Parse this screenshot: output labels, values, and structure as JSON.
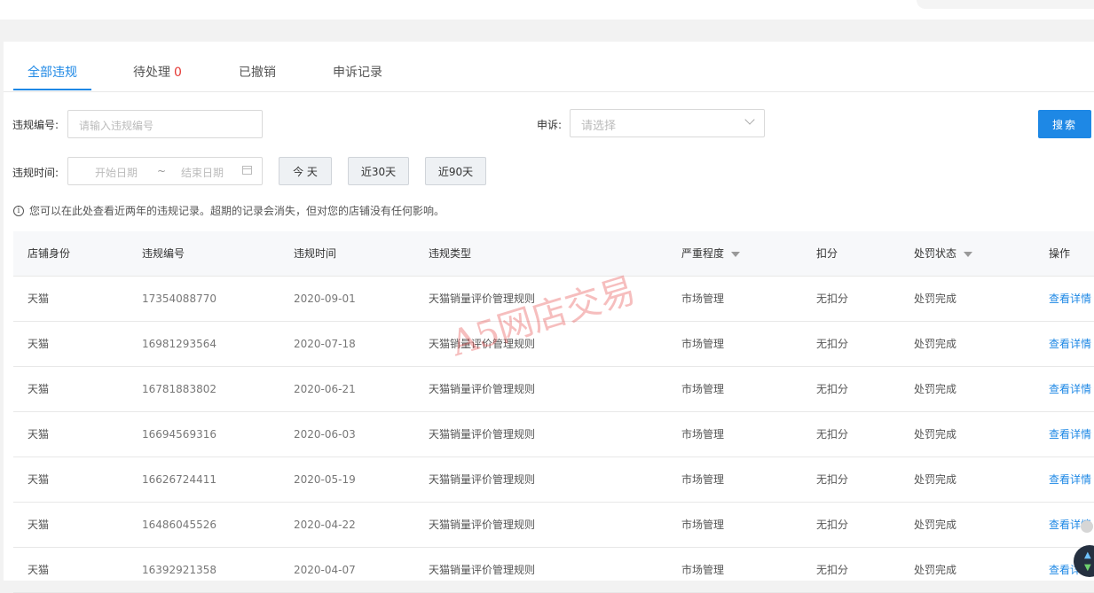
{
  "tabs": [
    {
      "label": "全部违规",
      "count": ""
    },
    {
      "label": "待处理",
      "count": "0"
    },
    {
      "label": "已撤销",
      "count": ""
    },
    {
      "label": "申诉记录",
      "count": ""
    }
  ],
  "filters": {
    "violation_no_label": "违规编号:",
    "violation_no_placeholder": "请输入违规编号",
    "appeal_label": "申诉:",
    "appeal_placeholder": "请选择",
    "search_button": "搜索",
    "time_label": "违规时间:",
    "start_placeholder": "开始日期",
    "separator": "~",
    "end_placeholder": "结束日期",
    "today_button": "今 天",
    "last30_button": "近30天",
    "last90_button": "近90天"
  },
  "notice": "您可以在此处查看近两年的违规记录。超期的记录会消失，但对您的店铺没有任何影响。",
  "table": {
    "headers": [
      "店铺身份",
      "违规编号",
      "违规时间",
      "违规类型",
      "严重程度",
      "扣分",
      "处罚状态",
      "操作"
    ],
    "rows": [
      [
        "天猫",
        "17354088770",
        "2020-09-01",
        "天猫销量评价管理规则",
        "市场管理",
        "无扣分",
        "处罚完成",
        "查看详情"
      ],
      [
        "天猫",
        "16981293564",
        "2020-07-18",
        "天猫销量评价管理规则",
        "市场管理",
        "无扣分",
        "处罚完成",
        "查看详情"
      ],
      [
        "天猫",
        "16781883802",
        "2020-06-21",
        "天猫销量评价管理规则",
        "市场管理",
        "无扣分",
        "处罚完成",
        "查看详情"
      ],
      [
        "天猫",
        "16694569316",
        "2020-06-03",
        "天猫销量评价管理规则",
        "市场管理",
        "无扣分",
        "处罚完成",
        "查看详情"
      ],
      [
        "天猫",
        "16626724411",
        "2020-05-19",
        "天猫销量评价管理规则",
        "市场管理",
        "无扣分",
        "处罚完成",
        "查看详情"
      ],
      [
        "天猫",
        "16486045526",
        "2020-04-22",
        "天猫销量评价管理规则",
        "市场管理",
        "无扣分",
        "处罚完成",
        "查看详情"
      ],
      [
        "天猫",
        "16392921358",
        "2020-04-07",
        "天猫销量评价管理规则",
        "市场管理",
        "无扣分",
        "处罚完成",
        "查看详情"
      ]
    ]
  },
  "watermark": "A5网店交易",
  "colors": {
    "accent": "#1e88e5",
    "danger": "#e53935"
  }
}
